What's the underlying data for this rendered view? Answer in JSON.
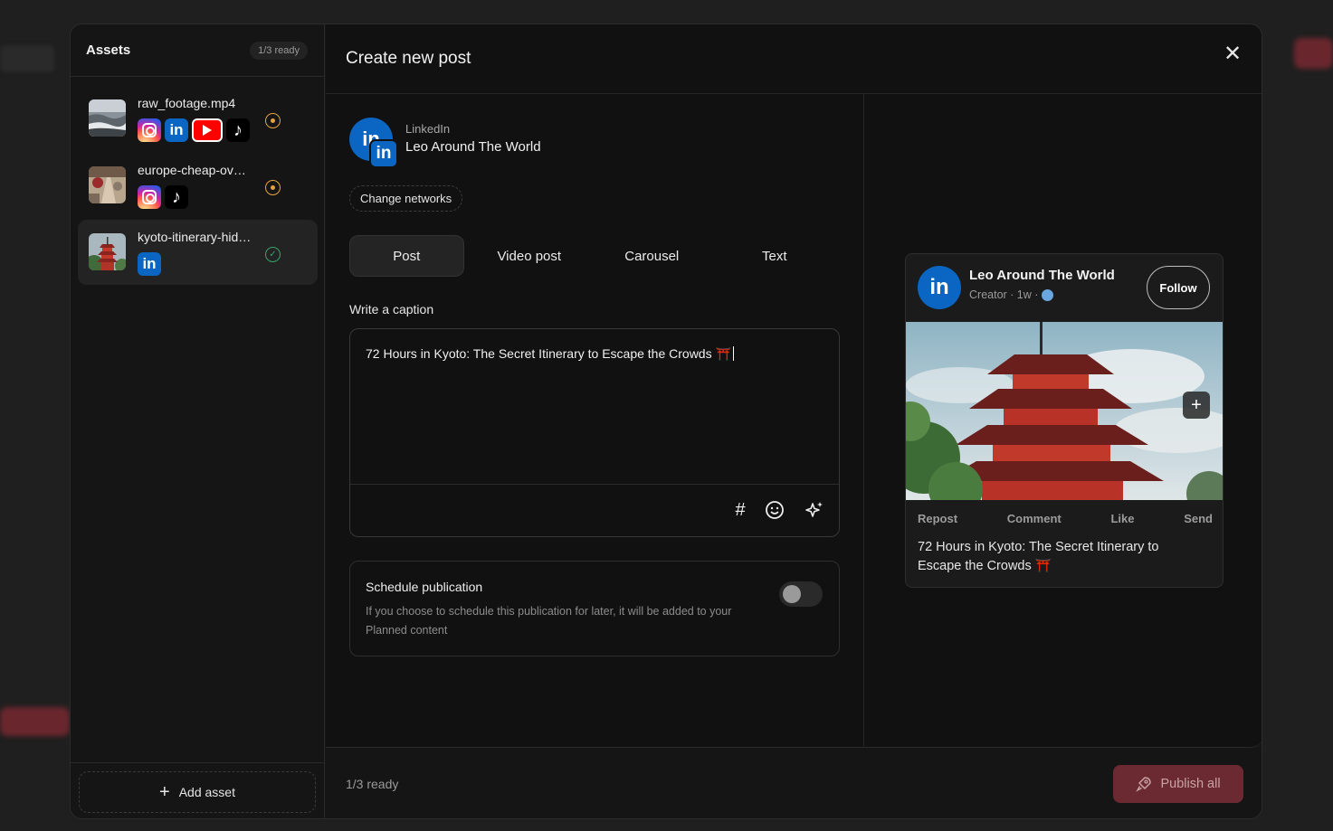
{
  "assets": {
    "title": "Assets",
    "ready": "1/3 ready",
    "items": [
      {
        "name": "raw_footage.mp4",
        "networks": [
          "instagram-icon",
          "linkedin-icon",
          "youtube-icon",
          "tiktok-icon"
        ],
        "status": "pending"
      },
      {
        "name": "europe-cheap-ov…",
        "networks": [
          "instagram-icon",
          "tiktok-icon"
        ],
        "status": "pending"
      },
      {
        "name": "kyoto-itinerary-hid…",
        "networks": [
          "linkedin-icon"
        ],
        "status": "done"
      }
    ],
    "add_label": "Add asset"
  },
  "main": {
    "title": "Create new post",
    "account": {
      "network": "LinkedIn",
      "name": "Leo Around The World"
    },
    "change_networks": "Change networks",
    "tabs": [
      {
        "label": "Post",
        "active": true
      },
      {
        "label": "Video post",
        "active": false
      },
      {
        "label": "Carousel",
        "active": false
      },
      {
        "label": "Text",
        "active": false
      }
    ],
    "caption_label": "Write a caption",
    "caption_value": "72 Hours in Kyoto: The Secret Itinerary to Escape the Crowds ⛩️",
    "schedule": {
      "title": "Schedule publication",
      "description": "If you choose to schedule this publication for later, it will be added to your Planned content",
      "enabled": false
    }
  },
  "preview": {
    "name": "Leo Around The World",
    "meta": "Creator · 1w ·",
    "follow": "Follow",
    "actions": [
      "Repost",
      "Comment",
      "Like",
      "Send"
    ],
    "caption": "72 Hours in Kyoto: The Secret Itinerary to Escape the Crowds ⛩️"
  },
  "footer": {
    "ready": "1/3 ready",
    "publish": "Publish all"
  },
  "colors": {
    "linkedin": "#0a66c2",
    "pending": "#e6a23c",
    "done": "#3aa36b",
    "publish_bg": "#6b2a31"
  }
}
